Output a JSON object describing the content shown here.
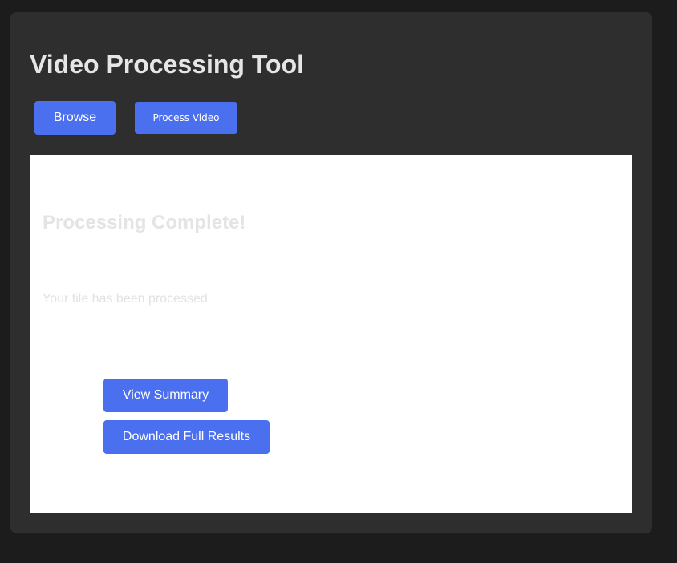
{
  "app": {
    "title": "Video Processing Tool"
  },
  "toolbar": {
    "browse_label": "Browse",
    "process_label": "Process Video"
  },
  "result": {
    "title": "Processing Complete!",
    "message": "Your file has been processed.",
    "view_summary_label": "View Summary",
    "download_label": "Download Full Results"
  },
  "colors": {
    "page_background": "#1c1c1c",
    "card_background": "#2e2e2e",
    "accent": "#4a70f0",
    "panel_background": "#ffffff"
  }
}
